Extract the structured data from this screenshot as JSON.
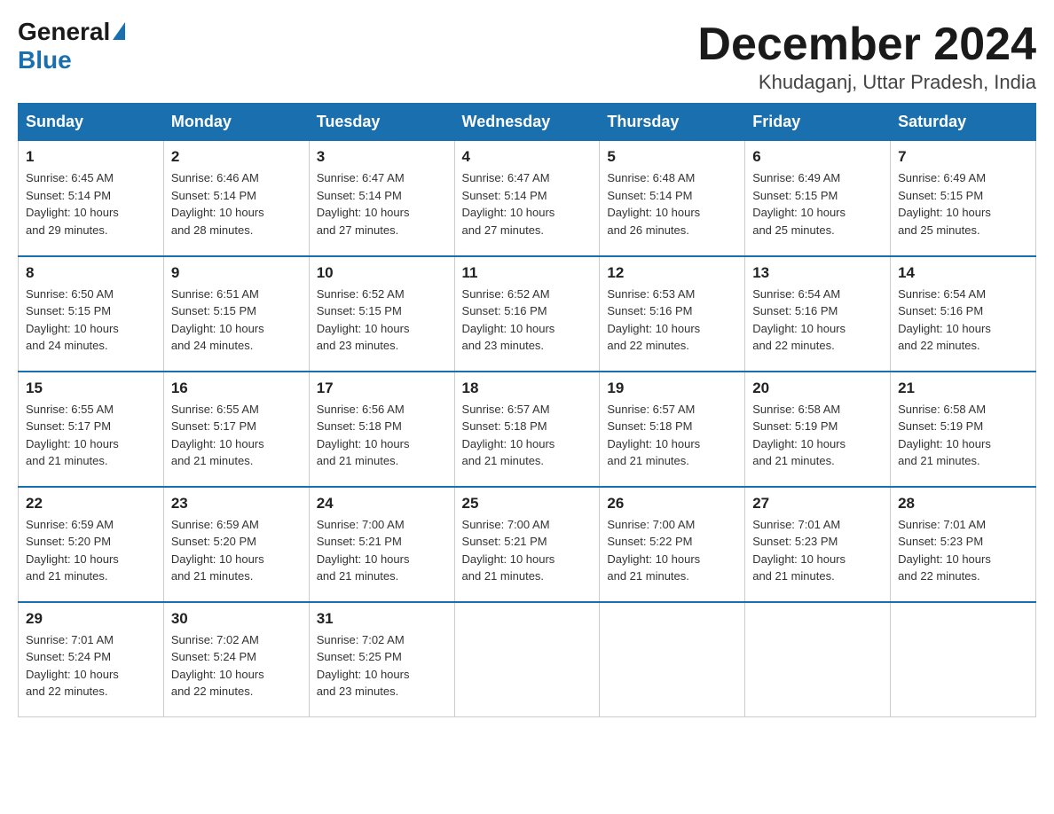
{
  "logo": {
    "general": "General",
    "blue": "Blue"
  },
  "title": "December 2024",
  "location": "Khudaganj, Uttar Pradesh, India",
  "weekdays": [
    "Sunday",
    "Monday",
    "Tuesday",
    "Wednesday",
    "Thursday",
    "Friday",
    "Saturday"
  ],
  "weeks": [
    [
      {
        "day": "1",
        "sunrise": "6:45 AM",
        "sunset": "5:14 PM",
        "daylight": "10 hours and 29 minutes."
      },
      {
        "day": "2",
        "sunrise": "6:46 AM",
        "sunset": "5:14 PM",
        "daylight": "10 hours and 28 minutes."
      },
      {
        "day": "3",
        "sunrise": "6:47 AM",
        "sunset": "5:14 PM",
        "daylight": "10 hours and 27 minutes."
      },
      {
        "day": "4",
        "sunrise": "6:47 AM",
        "sunset": "5:14 PM",
        "daylight": "10 hours and 27 minutes."
      },
      {
        "day": "5",
        "sunrise": "6:48 AM",
        "sunset": "5:14 PM",
        "daylight": "10 hours and 26 minutes."
      },
      {
        "day": "6",
        "sunrise": "6:49 AM",
        "sunset": "5:15 PM",
        "daylight": "10 hours and 25 minutes."
      },
      {
        "day": "7",
        "sunrise": "6:49 AM",
        "sunset": "5:15 PM",
        "daylight": "10 hours and 25 minutes."
      }
    ],
    [
      {
        "day": "8",
        "sunrise": "6:50 AM",
        "sunset": "5:15 PM",
        "daylight": "10 hours and 24 minutes."
      },
      {
        "day": "9",
        "sunrise": "6:51 AM",
        "sunset": "5:15 PM",
        "daylight": "10 hours and 24 minutes."
      },
      {
        "day": "10",
        "sunrise": "6:52 AM",
        "sunset": "5:15 PM",
        "daylight": "10 hours and 23 minutes."
      },
      {
        "day": "11",
        "sunrise": "6:52 AM",
        "sunset": "5:16 PM",
        "daylight": "10 hours and 23 minutes."
      },
      {
        "day": "12",
        "sunrise": "6:53 AM",
        "sunset": "5:16 PM",
        "daylight": "10 hours and 22 minutes."
      },
      {
        "day": "13",
        "sunrise": "6:54 AM",
        "sunset": "5:16 PM",
        "daylight": "10 hours and 22 minutes."
      },
      {
        "day": "14",
        "sunrise": "6:54 AM",
        "sunset": "5:16 PM",
        "daylight": "10 hours and 22 minutes."
      }
    ],
    [
      {
        "day": "15",
        "sunrise": "6:55 AM",
        "sunset": "5:17 PM",
        "daylight": "10 hours and 21 minutes."
      },
      {
        "day": "16",
        "sunrise": "6:55 AM",
        "sunset": "5:17 PM",
        "daylight": "10 hours and 21 minutes."
      },
      {
        "day": "17",
        "sunrise": "6:56 AM",
        "sunset": "5:18 PM",
        "daylight": "10 hours and 21 minutes."
      },
      {
        "day": "18",
        "sunrise": "6:57 AM",
        "sunset": "5:18 PM",
        "daylight": "10 hours and 21 minutes."
      },
      {
        "day": "19",
        "sunrise": "6:57 AM",
        "sunset": "5:18 PM",
        "daylight": "10 hours and 21 minutes."
      },
      {
        "day": "20",
        "sunrise": "6:58 AM",
        "sunset": "5:19 PM",
        "daylight": "10 hours and 21 minutes."
      },
      {
        "day": "21",
        "sunrise": "6:58 AM",
        "sunset": "5:19 PM",
        "daylight": "10 hours and 21 minutes."
      }
    ],
    [
      {
        "day": "22",
        "sunrise": "6:59 AM",
        "sunset": "5:20 PM",
        "daylight": "10 hours and 21 minutes."
      },
      {
        "day": "23",
        "sunrise": "6:59 AM",
        "sunset": "5:20 PM",
        "daylight": "10 hours and 21 minutes."
      },
      {
        "day": "24",
        "sunrise": "7:00 AM",
        "sunset": "5:21 PM",
        "daylight": "10 hours and 21 minutes."
      },
      {
        "day": "25",
        "sunrise": "7:00 AM",
        "sunset": "5:21 PM",
        "daylight": "10 hours and 21 minutes."
      },
      {
        "day": "26",
        "sunrise": "7:00 AM",
        "sunset": "5:22 PM",
        "daylight": "10 hours and 21 minutes."
      },
      {
        "day": "27",
        "sunrise": "7:01 AM",
        "sunset": "5:23 PM",
        "daylight": "10 hours and 21 minutes."
      },
      {
        "day": "28",
        "sunrise": "7:01 AM",
        "sunset": "5:23 PM",
        "daylight": "10 hours and 22 minutes."
      }
    ],
    [
      {
        "day": "29",
        "sunrise": "7:01 AM",
        "sunset": "5:24 PM",
        "daylight": "10 hours and 22 minutes."
      },
      {
        "day": "30",
        "sunrise": "7:02 AM",
        "sunset": "5:24 PM",
        "daylight": "10 hours and 22 minutes."
      },
      {
        "day": "31",
        "sunrise": "7:02 AM",
        "sunset": "5:25 PM",
        "daylight": "10 hours and 23 minutes."
      },
      null,
      null,
      null,
      null
    ]
  ]
}
